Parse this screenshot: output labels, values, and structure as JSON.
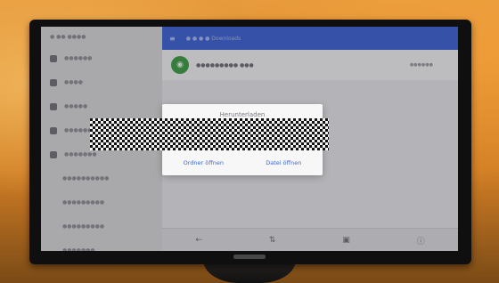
{
  "scene": {
    "wall_color": "#d9892d"
  },
  "sidebar": {
    "header": "●  ●● ●●●●",
    "items": [
      {
        "label": "●●●●●●",
        "icon": "folder-icon"
      },
      {
        "label": "●●●●",
        "icon": "phone-icon"
      },
      {
        "label": "●●●●●",
        "icon": "sd-card-icon"
      },
      {
        "label": "●●●●●●",
        "icon": "cloud-icon"
      },
      {
        "label": "●●●●●●●",
        "icon": "tools-icon"
      }
    ],
    "subitems": [
      "●●●●●●●●●●",
      "●●●●●●●●●",
      "●●●●●●●●●",
      "●●●●●●●"
    ]
  },
  "appbar": {
    "menu_glyph": "≡",
    "breadcrumb": "●  ●  ●  ● Downloads",
    "color": "#3a5fd0"
  },
  "file": {
    "name": "●●●●●●●●● ●●●",
    "meta": "●●●●●●",
    "avatar_glyph": "◉"
  },
  "dialog": {
    "title": "Herunterladen",
    "open_folder": "Ordner öffnen",
    "open_file": "Datei öffnen"
  },
  "bottom_bar": {
    "icons": [
      "back-icon",
      "sort-icon",
      "copy-icon",
      "info-icon"
    ],
    "glyphs": [
      "←",
      "⇅",
      "▣",
      "ⓘ"
    ]
  }
}
